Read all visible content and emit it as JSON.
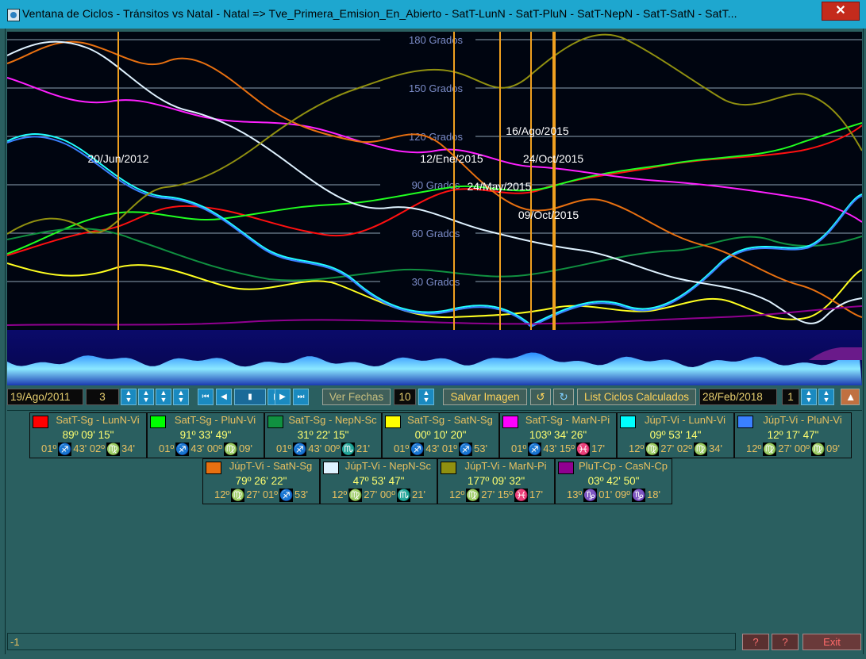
{
  "window": {
    "title": "Ventana de Ciclos - Tránsitos vs Natal - Natal => Tve_Primera_Emision_En_Abierto - SatT-LunN - SatT-PluN - SatT-NepN - SatT-SatN - SatT...",
    "close_glyph": "✕"
  },
  "chart_data": {
    "type": "line",
    "y_labels": [
      "180 Grados",
      "150 Grados",
      "120 Grados",
      "90 Grados",
      "60 Grados",
      "30 Grados"
    ],
    "ylim": [
      0,
      180
    ],
    "background": "#000510",
    "grid_color": "#8ea2b4",
    "vertical_marker_color": "#f0a020",
    "event_markers": [
      {
        "label": "20/Jun/2012"
      },
      {
        "label": "12/Ene/2015"
      },
      {
        "label": "24/May/2015"
      },
      {
        "label": "16/Ago/2015"
      },
      {
        "label": "24/Oct/2015"
      },
      {
        "label": "09/Oct/2015"
      }
    ],
    "series": [
      {
        "name": "SatT-Sg - LunN-Vi",
        "color": "#ff1010"
      },
      {
        "name": "SatT-Sg - PluN-Vi",
        "color": "#20ff20"
      },
      {
        "name": "SatT-Sg - NepN-Sc",
        "color": "#109040"
      },
      {
        "name": "SatT-Sg - SatN-Sg",
        "color": "#ffff20"
      },
      {
        "name": "SatT-Sg - MarN-Pi",
        "color": "#ff20ff"
      },
      {
        "name": "JúpT-Vi - LunN-Vi",
        "color": "#20ffff"
      },
      {
        "name": "JúpT-Vi - PluN-Vi",
        "color": "#3a80ff"
      },
      {
        "name": "JúpT-Vi - SatN-Sg",
        "color": "#e87010"
      },
      {
        "name": "JúpT-Vi - NepN-Sc",
        "color": "#dff2ff"
      },
      {
        "name": "JúpT-Vi - MarN-Pi",
        "color": "#909010"
      },
      {
        "name": "PluT-Cp - CasN-Cp",
        "color": "#900090"
      }
    ]
  },
  "toolbar": {
    "start_date": "19/Ago/2011",
    "step_value": "3",
    "ver_fechas_label": "Ver Fechas",
    "fechas_count": "10",
    "salvar_imagen_label": "Salvar Imagen",
    "list_ciclos_label": "List Ciclos Calculados",
    "end_date": "28/Feb/2018",
    "end_step": "1"
  },
  "cards": [
    {
      "name": "SatT-Sg - LunN-Vi",
      "color": "#ff0000",
      "degree": "89º 09' 15\"",
      "p1d": "01º",
      "g1": "♐",
      "m1": "43'",
      "p2d": "02º",
      "g2": "♍",
      "m2": "34'"
    },
    {
      "name": "SatT-Sg - PluN-Vi",
      "color": "#00ff00",
      "degree": "91º 33' 49\"",
      "p1d": "01º",
      "g1": "♐",
      "m1": "43'",
      "p2d": "00º",
      "g2": "♍",
      "m2": "09'"
    },
    {
      "name": "SatT-Sg - NepN-Sc",
      "color": "#109040",
      "degree": "31º 22' 15\"",
      "p1d": "01º",
      "g1": "♐",
      "m1": "43'",
      "p2d": "00º",
      "g2": "♏",
      "m2": "21'"
    },
    {
      "name": "SatT-Sg - SatN-Sg",
      "color": "#ffff00",
      "degree": "00º 10' 20\"",
      "p1d": "01º",
      "g1": "♐",
      "m1": "43'",
      "p2d": "01º",
      "g2": "♐",
      "m2": "53'"
    },
    {
      "name": "SatT-Sg - MarN-Pi",
      "color": "#ff00ff",
      "degree": "103º 34' 26\"",
      "p1d": "01º",
      "g1": "♐",
      "m1": "43'",
      "p2d": "15º",
      "g2": "♓",
      "m2": "17'"
    },
    {
      "name": "JúpT-Vi - LunN-Vi",
      "color": "#00ffff",
      "degree": "09º 53' 14\"",
      "p1d": "12º",
      "g1": "♍",
      "m1": "27'",
      "p2d": "02º",
      "g2": "♍",
      "m2": "34'"
    },
    {
      "name": "JúpT-Vi - PluN-Vi",
      "color": "#3a80ff",
      "degree": "12º 17' 47\"",
      "p1d": "12º",
      "g1": "♍",
      "m1": "27'",
      "p2d": "00º",
      "g2": "♍",
      "m2": "09'"
    },
    {
      "name": "JúpT-Vi - SatN-Sg",
      "color": "#e87010",
      "degree": "79º 26' 22\"",
      "p1d": "12º",
      "g1": "♍",
      "m1": "27'",
      "p2d": "01º",
      "g2": "♐",
      "m2": "53'"
    },
    {
      "name": "JúpT-Vi - NepN-Sc",
      "color": "#dff2ff",
      "degree": "47º 53' 47\"",
      "p1d": "12º",
      "g1": "♍",
      "m1": "27'",
      "p2d": "00º",
      "g2": "♏",
      "m2": "21'"
    },
    {
      "name": "JúpT-Vi - MarN-Pi",
      "color": "#909010",
      "degree": "177º 09' 32\"",
      "p1d": "12º",
      "g1": "♍",
      "m1": "27'",
      "p2d": "15º",
      "g2": "♓",
      "m2": "17'"
    },
    {
      "name": "PluT-Cp - CasN-Cp",
      "color": "#900090",
      "degree": "03º 42' 50\"",
      "p1d": "13º",
      "g1": "♑",
      "m1": "01'",
      "p2d": "09º",
      "g2": "♑",
      "m2": "18'"
    }
  ],
  "statusbar": {
    "value": "-1",
    "btn1": "?",
    "btn2": "?",
    "exit_label": "Exit"
  }
}
